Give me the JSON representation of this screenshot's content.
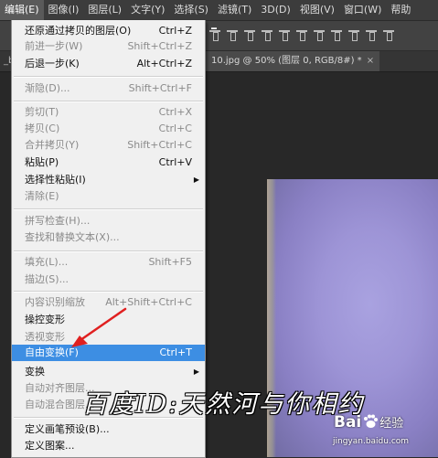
{
  "menubar": {
    "items": [
      "编辑(E)",
      "图像(I)",
      "图层(L)",
      "文字(Y)",
      "选择(S)",
      "滤镜(T)",
      "3D(D)",
      "视图(V)",
      "窗口(W)",
      "帮助"
    ]
  },
  "tabs": {
    "left_fragment": "_bo",
    "active_doc": "10.jpg @ 50% (图层 0, RGB/8#) *",
    "close_glyph": "×"
  },
  "edit_menu": {
    "items": [
      {
        "label": "还原通过拷贝的图层(O)",
        "shortcut": "Ctrl+Z",
        "enabled": true
      },
      {
        "label": "前进一步(W)",
        "shortcut": "Shift+Ctrl+Z",
        "enabled": false
      },
      {
        "label": "后退一步(K)",
        "shortcut": "Alt+Ctrl+Z",
        "enabled": true
      },
      {
        "label": "渐隐(D)...",
        "shortcut": "Shift+Ctrl+F",
        "enabled": false
      },
      {
        "label": "剪切(T)",
        "shortcut": "Ctrl+X",
        "enabled": false
      },
      {
        "label": "拷贝(C)",
        "shortcut": "Ctrl+C",
        "enabled": false
      },
      {
        "label": "合并拷贝(Y)",
        "shortcut": "Shift+Ctrl+C",
        "enabled": false
      },
      {
        "label": "粘贴(P)",
        "shortcut": "Ctrl+V",
        "enabled": true
      },
      {
        "label": "选择性粘贴(I)",
        "shortcut": "",
        "enabled": true,
        "submenu": true
      },
      {
        "label": "清除(E)",
        "shortcut": "",
        "enabled": false
      },
      {
        "label": "拼写检查(H)...",
        "shortcut": "",
        "enabled": false
      },
      {
        "label": "查找和替换文本(X)...",
        "shortcut": "",
        "enabled": false
      },
      {
        "label": "填充(L)...",
        "shortcut": "Shift+F5",
        "enabled": false
      },
      {
        "label": "描边(S)...",
        "shortcut": "",
        "enabled": false
      },
      {
        "label": "内容识别缩放",
        "shortcut": "Alt+Shift+Ctrl+C",
        "enabled": false
      },
      {
        "label": "操控变形",
        "shortcut": "",
        "enabled": true
      },
      {
        "label": "透视变形",
        "shortcut": "",
        "enabled": false
      },
      {
        "label": "自由变换(F)",
        "shortcut": "Ctrl+T",
        "enabled": true,
        "highlighted": true
      },
      {
        "label": "变换",
        "shortcut": "",
        "enabled": true,
        "submenu": true
      },
      {
        "label": "自动对齐图层...",
        "shortcut": "",
        "enabled": false
      },
      {
        "label": "自动混合图层...",
        "shortcut": "",
        "enabled": false
      },
      {
        "label": "定义画笔预设(B)...",
        "shortcut": "",
        "enabled": true
      },
      {
        "label": "定义图案...",
        "shortcut": "",
        "enabled": true
      }
    ],
    "submenu_glyph": "▶"
  },
  "watermark": {
    "text": "百度ID:天然河与你相约",
    "brand_left": "Bai",
    "brand_right": "经验",
    "url": "jingyan.baidu.com"
  },
  "colors": {
    "highlight": "#3d8ee3",
    "annotation_arrow": "#e02020"
  }
}
